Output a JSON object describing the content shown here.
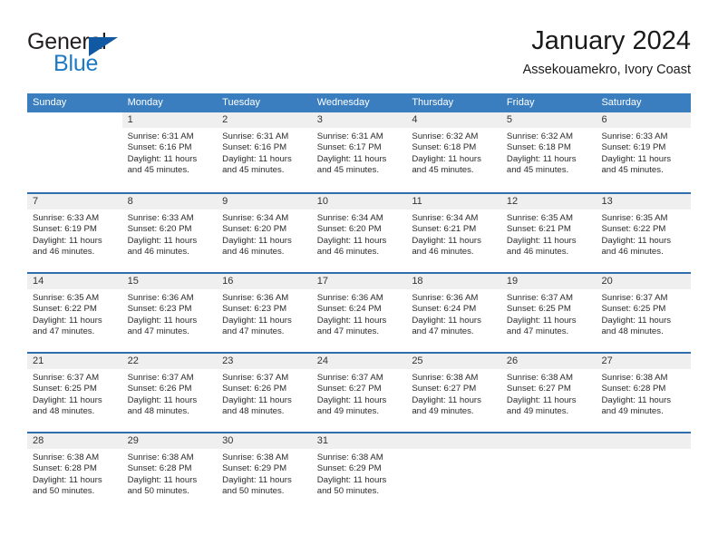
{
  "brand": {
    "word1": "General",
    "word2": "Blue",
    "triangle_color": "#1259a3",
    "blue_color": "#1f7ac4"
  },
  "header": {
    "title": "January 2024",
    "location": "Assekouamekro, Ivory Coast"
  },
  "theme": {
    "header_blue": "#3a7ebf",
    "row_divider_blue": "#2f6fae",
    "daynum_bg": "#efefef"
  },
  "weekdays": [
    "Sunday",
    "Monday",
    "Tuesday",
    "Wednesday",
    "Thursday",
    "Friday",
    "Saturday"
  ],
  "weeks": [
    [
      {
        "day": "",
        "sunrise": "",
        "sunset": "",
        "daylight": "",
        "blank": true
      },
      {
        "day": "1",
        "sunrise": "Sunrise: 6:31 AM",
        "sunset": "Sunset: 6:16 PM",
        "daylight": "Daylight: 11 hours and 45 minutes."
      },
      {
        "day": "2",
        "sunrise": "Sunrise: 6:31 AM",
        "sunset": "Sunset: 6:16 PM",
        "daylight": "Daylight: 11 hours and 45 minutes."
      },
      {
        "day": "3",
        "sunrise": "Sunrise: 6:31 AM",
        "sunset": "Sunset: 6:17 PM",
        "daylight": "Daylight: 11 hours and 45 minutes."
      },
      {
        "day": "4",
        "sunrise": "Sunrise: 6:32 AM",
        "sunset": "Sunset: 6:18 PM",
        "daylight": "Daylight: 11 hours and 45 minutes."
      },
      {
        "day": "5",
        "sunrise": "Sunrise: 6:32 AM",
        "sunset": "Sunset: 6:18 PM",
        "daylight": "Daylight: 11 hours and 45 minutes."
      },
      {
        "day": "6",
        "sunrise": "Sunrise: 6:33 AM",
        "sunset": "Sunset: 6:19 PM",
        "daylight": "Daylight: 11 hours and 45 minutes."
      }
    ],
    [
      {
        "day": "7",
        "sunrise": "Sunrise: 6:33 AM",
        "sunset": "Sunset: 6:19 PM",
        "daylight": "Daylight: 11 hours and 46 minutes."
      },
      {
        "day": "8",
        "sunrise": "Sunrise: 6:33 AM",
        "sunset": "Sunset: 6:20 PM",
        "daylight": "Daylight: 11 hours and 46 minutes."
      },
      {
        "day": "9",
        "sunrise": "Sunrise: 6:34 AM",
        "sunset": "Sunset: 6:20 PM",
        "daylight": "Daylight: 11 hours and 46 minutes."
      },
      {
        "day": "10",
        "sunrise": "Sunrise: 6:34 AM",
        "sunset": "Sunset: 6:20 PM",
        "daylight": "Daylight: 11 hours and 46 minutes."
      },
      {
        "day": "11",
        "sunrise": "Sunrise: 6:34 AM",
        "sunset": "Sunset: 6:21 PM",
        "daylight": "Daylight: 11 hours and 46 minutes."
      },
      {
        "day": "12",
        "sunrise": "Sunrise: 6:35 AM",
        "sunset": "Sunset: 6:21 PM",
        "daylight": "Daylight: 11 hours and 46 minutes."
      },
      {
        "day": "13",
        "sunrise": "Sunrise: 6:35 AM",
        "sunset": "Sunset: 6:22 PM",
        "daylight": "Daylight: 11 hours and 46 minutes."
      }
    ],
    [
      {
        "day": "14",
        "sunrise": "Sunrise: 6:35 AM",
        "sunset": "Sunset: 6:22 PM",
        "daylight": "Daylight: 11 hours and 47 minutes."
      },
      {
        "day": "15",
        "sunrise": "Sunrise: 6:36 AM",
        "sunset": "Sunset: 6:23 PM",
        "daylight": "Daylight: 11 hours and 47 minutes."
      },
      {
        "day": "16",
        "sunrise": "Sunrise: 6:36 AM",
        "sunset": "Sunset: 6:23 PM",
        "daylight": "Daylight: 11 hours and 47 minutes."
      },
      {
        "day": "17",
        "sunrise": "Sunrise: 6:36 AM",
        "sunset": "Sunset: 6:24 PM",
        "daylight": "Daylight: 11 hours and 47 minutes."
      },
      {
        "day": "18",
        "sunrise": "Sunrise: 6:36 AM",
        "sunset": "Sunset: 6:24 PM",
        "daylight": "Daylight: 11 hours and 47 minutes."
      },
      {
        "day": "19",
        "sunrise": "Sunrise: 6:37 AM",
        "sunset": "Sunset: 6:25 PM",
        "daylight": "Daylight: 11 hours and 47 minutes."
      },
      {
        "day": "20",
        "sunrise": "Sunrise: 6:37 AM",
        "sunset": "Sunset: 6:25 PM",
        "daylight": "Daylight: 11 hours and 48 minutes."
      }
    ],
    [
      {
        "day": "21",
        "sunrise": "Sunrise: 6:37 AM",
        "sunset": "Sunset: 6:25 PM",
        "daylight": "Daylight: 11 hours and 48 minutes."
      },
      {
        "day": "22",
        "sunrise": "Sunrise: 6:37 AM",
        "sunset": "Sunset: 6:26 PM",
        "daylight": "Daylight: 11 hours and 48 minutes."
      },
      {
        "day": "23",
        "sunrise": "Sunrise: 6:37 AM",
        "sunset": "Sunset: 6:26 PM",
        "daylight": "Daylight: 11 hours and 48 minutes."
      },
      {
        "day": "24",
        "sunrise": "Sunrise: 6:37 AM",
        "sunset": "Sunset: 6:27 PM",
        "daylight": "Daylight: 11 hours and 49 minutes."
      },
      {
        "day": "25",
        "sunrise": "Sunrise: 6:38 AM",
        "sunset": "Sunset: 6:27 PM",
        "daylight": "Daylight: 11 hours and 49 minutes."
      },
      {
        "day": "26",
        "sunrise": "Sunrise: 6:38 AM",
        "sunset": "Sunset: 6:27 PM",
        "daylight": "Daylight: 11 hours and 49 minutes."
      },
      {
        "day": "27",
        "sunrise": "Sunrise: 6:38 AM",
        "sunset": "Sunset: 6:28 PM",
        "daylight": "Daylight: 11 hours and 49 minutes."
      }
    ],
    [
      {
        "day": "28",
        "sunrise": "Sunrise: 6:38 AM",
        "sunset": "Sunset: 6:28 PM",
        "daylight": "Daylight: 11 hours and 50 minutes."
      },
      {
        "day": "29",
        "sunrise": "Sunrise: 6:38 AM",
        "sunset": "Sunset: 6:28 PM",
        "daylight": "Daylight: 11 hours and 50 minutes."
      },
      {
        "day": "30",
        "sunrise": "Sunrise: 6:38 AM",
        "sunset": "Sunset: 6:29 PM",
        "daylight": "Daylight: 11 hours and 50 minutes."
      },
      {
        "day": "31",
        "sunrise": "Sunrise: 6:38 AM",
        "sunset": "Sunset: 6:29 PM",
        "daylight": "Daylight: 11 hours and 50 minutes."
      },
      {
        "day": "",
        "sunrise": "",
        "sunset": "",
        "daylight": "",
        "empty": true
      },
      {
        "day": "",
        "sunrise": "",
        "sunset": "",
        "daylight": "",
        "empty": true
      },
      {
        "day": "",
        "sunrise": "",
        "sunset": "",
        "daylight": "",
        "empty": true
      }
    ]
  ]
}
